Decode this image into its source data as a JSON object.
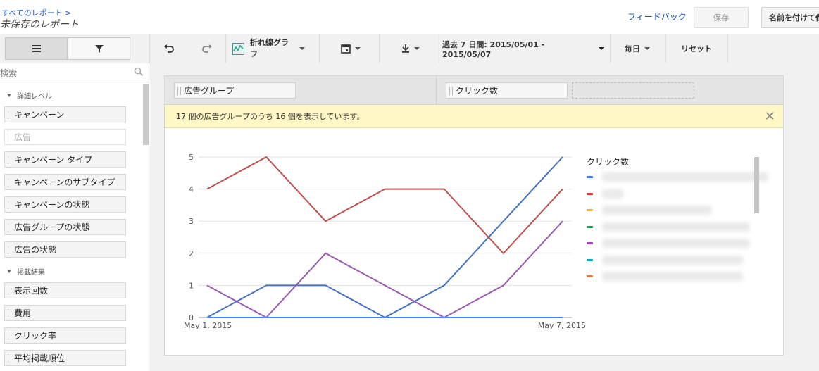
{
  "header": {
    "breadcrumb": "すべてのレポート >",
    "title": "未保存のレポート",
    "feedback": "フィードバック",
    "save": "保存",
    "save_as": "名前を付けて保存"
  },
  "toolbar": {
    "chart_type": "折れ線グラフ",
    "date_range": "過去 7 日間: 2015/05/01 - 2015/05/07",
    "granularity": "毎日",
    "reset": "リセット",
    "icons": [
      "table-view-icon",
      "filter-icon",
      "undo-icon",
      "redo-icon",
      "line-chart-icon",
      "calendar-icon",
      "download-icon"
    ]
  },
  "sidebar": {
    "search_placeholder": "検索",
    "group_detail": "詳細レベル",
    "detail_items": [
      {
        "label": "キャンペーン",
        "enabled": true
      },
      {
        "label": "広告",
        "enabled": false
      },
      {
        "label": "キャンペーン タイプ",
        "enabled": true
      },
      {
        "label": "キャンペーンのサブタイプ",
        "enabled": true
      },
      {
        "label": "キャンペーンの状態",
        "enabled": true
      },
      {
        "label": "広告グループの状態",
        "enabled": true
      },
      {
        "label": "広告の状態",
        "enabled": true
      }
    ],
    "group_performance": "掲載結果",
    "performance_items": [
      {
        "label": "表示回数"
      },
      {
        "label": "費用"
      },
      {
        "label": "クリック率"
      },
      {
        "label": "平均掲載順位"
      }
    ]
  },
  "report": {
    "dimension": "広告グループ",
    "metric": "クリック数",
    "notice": "17 個の広告グループのうち 16 個を表示しています。"
  },
  "chart_data": {
    "type": "line",
    "x": [
      "May 1, 2015",
      "May 2, 2015",
      "May 3, 2015",
      "May 4, 2015",
      "May 5, 2015",
      "May 6, 2015",
      "May 7, 2015"
    ],
    "x_tick_labels": [
      "May 1, 2015",
      "May 7, 2015"
    ],
    "ylim": [
      0,
      5
    ],
    "y_ticks": [
      0,
      1,
      2,
      3,
      4,
      5
    ],
    "grid": true,
    "legend_title": "クリック数",
    "legend_position": "right",
    "series": [
      {
        "color": "#4472c4",
        "values": [
          0,
          1,
          1,
          0,
          1,
          3,
          5
        ]
      },
      {
        "color": "#c0504d",
        "values": [
          4,
          5,
          3,
          4,
          4,
          2,
          4
        ]
      },
      {
        "color": "#9b59b6",
        "values": [
          1,
          0,
          2,
          1,
          0,
          1,
          3
        ]
      },
      {
        "color": "#4285f4",
        "values": [
          0,
          0,
          0,
          0,
          0,
          0,
          0
        ]
      }
    ],
    "legend_colors": [
      "#4285f4",
      "#db4437",
      "#f4b400",
      "#0f9d58",
      "#ab47bc",
      "#00acc1",
      "#ff7043"
    ]
  }
}
